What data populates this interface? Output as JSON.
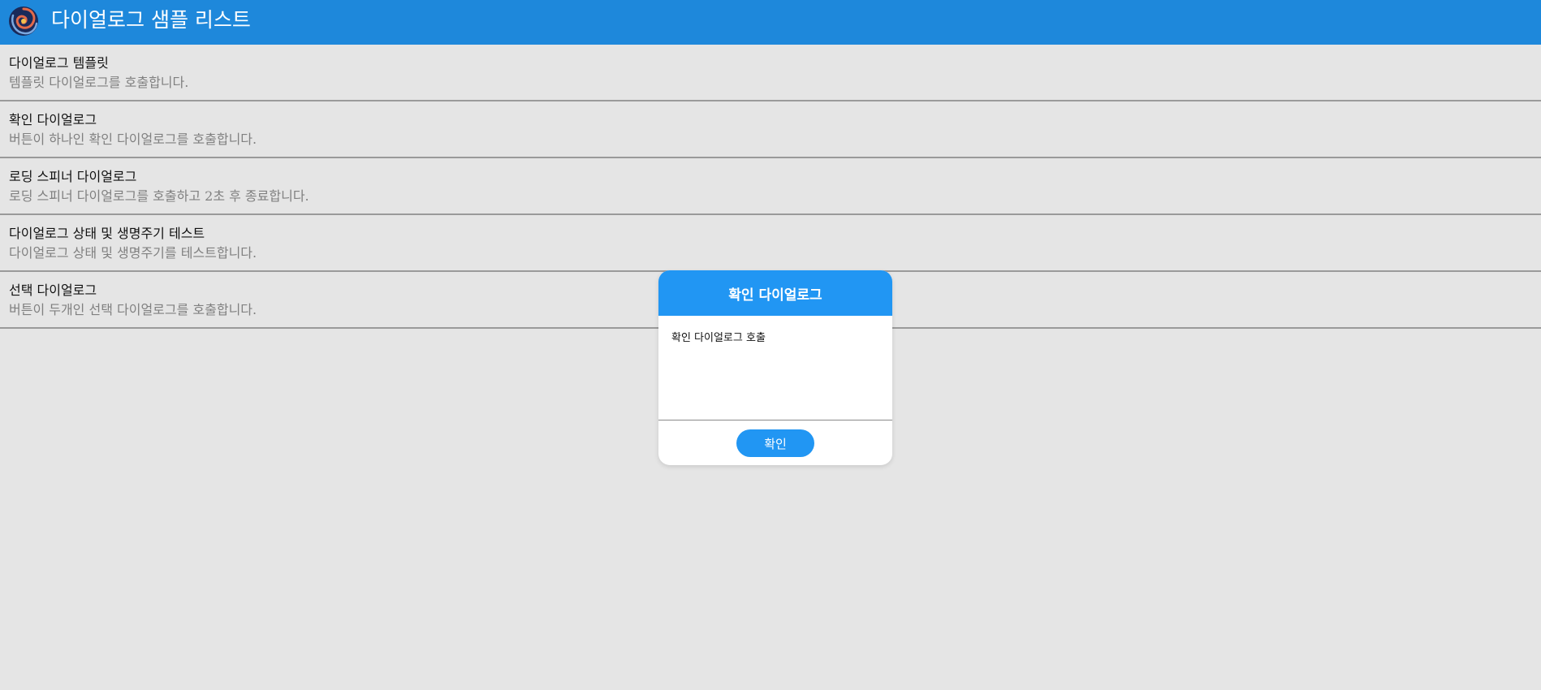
{
  "appbar": {
    "title": "다이얼로그 샘플 리스트",
    "logo_icon": "swirl-logo-icon",
    "background": "#1e88db"
  },
  "list": {
    "items": [
      {
        "title": "다이얼로그 템플릿",
        "description": "템플릿 다이얼로그를 호출합니다."
      },
      {
        "title": "확인 다이얼로그",
        "description": "버튼이 하나인 확인 다이얼로그를 호출합니다."
      },
      {
        "title": "로딩 스피너 다이얼로그",
        "description": "로딩 스피너 다이얼로그를 호출하고 2초 후 종료합니다."
      },
      {
        "title": "다이얼로그 상태 및 생명주기 테스트",
        "description": "다이얼로그 상태 및 생명주기를 테스트합니다."
      },
      {
        "title": "선택 다이얼로그",
        "description": "버튼이 두개인 선택 다이얼로그를 호출합니다."
      }
    ]
  },
  "dialog": {
    "title": "확인 다이얼로그",
    "message": "확인 다이얼로그 호출",
    "confirm_label": "확인",
    "accent": "#2196f3"
  }
}
